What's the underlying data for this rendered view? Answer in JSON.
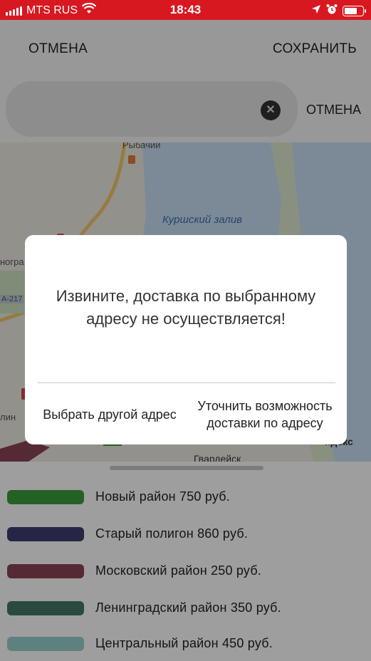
{
  "status_bar": {
    "carrier": "MTS RUS",
    "time": "18:43",
    "color": "#d81820"
  },
  "nav": {
    "cancel_label": "ОТМЕНА",
    "save_label": "СОХРАНИТЬ"
  },
  "search": {
    "value": "",
    "cancel_label": "ОТМЕНА",
    "clear_icon": "close-circle-icon"
  },
  "map": {
    "labels": {
      "town": "Рыбачий",
      "gulf": "Куршский залив",
      "road": "A-217",
      "left_partial": "ногра",
      "left_partial2": "лин",
      "street": "Гвардейск",
      "attribution": "ндекс"
    }
  },
  "legend": {
    "items": [
      {
        "label": "Новый район 750 руб.",
        "color": "#3a9d3a"
      },
      {
        "label": "Старый полигон 860 руб.",
        "color": "#3d3c72"
      },
      {
        "label": "Московский район 250 руб.",
        "color": "#8a4455"
      },
      {
        "label": "Ленинградский район 350 руб.",
        "color": "#437a63"
      },
      {
        "label": "Центральный район 450 руб.",
        "color": "#98d0cc"
      }
    ]
  },
  "dialog": {
    "message": "Извините, доставка по выбранному адресу не осуществляется!",
    "button_other": "Выбрать другой адрес",
    "button_clarify": "Уточнить возможность доставки по адресу"
  }
}
